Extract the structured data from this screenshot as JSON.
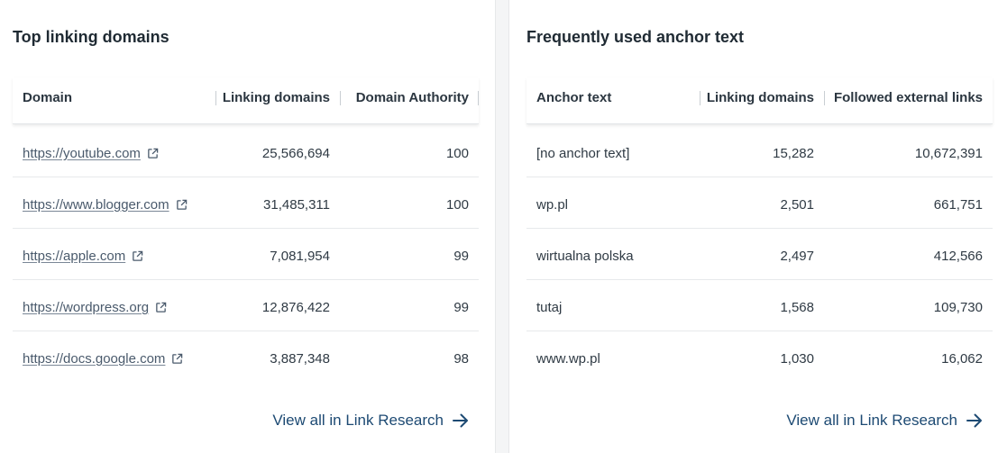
{
  "left_panel": {
    "title": "Top linking domains",
    "columns": [
      "Domain",
      "Linking domains",
      "Domain Authority"
    ],
    "rows": [
      {
        "domain": "https://youtube.com",
        "linking_domains": "25,566,694",
        "authority": "100"
      },
      {
        "domain": "https://www.blogger.com",
        "linking_domains": "31,485,311",
        "authority": "100"
      },
      {
        "domain": "https://apple.com",
        "linking_domains": "7,081,954",
        "authority": "99"
      },
      {
        "domain": "https://wordpress.org",
        "linking_domains": "12,876,422",
        "authority": "99"
      },
      {
        "domain": "https://docs.google.com",
        "linking_domains": "3,887,348",
        "authority": "98"
      }
    ],
    "view_all": "View all in Link Research"
  },
  "right_panel": {
    "title": "Frequently used anchor text",
    "columns": [
      "Anchor text",
      "Linking domains",
      "Followed external links"
    ],
    "rows": [
      {
        "anchor": "[no anchor text]",
        "linking_domains": "15,282",
        "followed": "10,672,391"
      },
      {
        "anchor": "wp.pl",
        "linking_domains": "2,501",
        "followed": "661,751"
      },
      {
        "anchor": "wirtualna polska",
        "linking_domains": "2,497",
        "followed": "412,566"
      },
      {
        "anchor": "tutaj",
        "linking_domains": "1,568",
        "followed": "109,730"
      },
      {
        "anchor": "www.wp.pl",
        "linking_domains": "1,030",
        "followed": "16,062"
      }
    ],
    "view_all": "View all in Link Research"
  },
  "icons": {
    "external_link": "external-link-icon",
    "arrow": "arrow-right-icon"
  },
  "colors": {
    "link": "#4a5a6c",
    "view_all": "#1d4a73"
  }
}
